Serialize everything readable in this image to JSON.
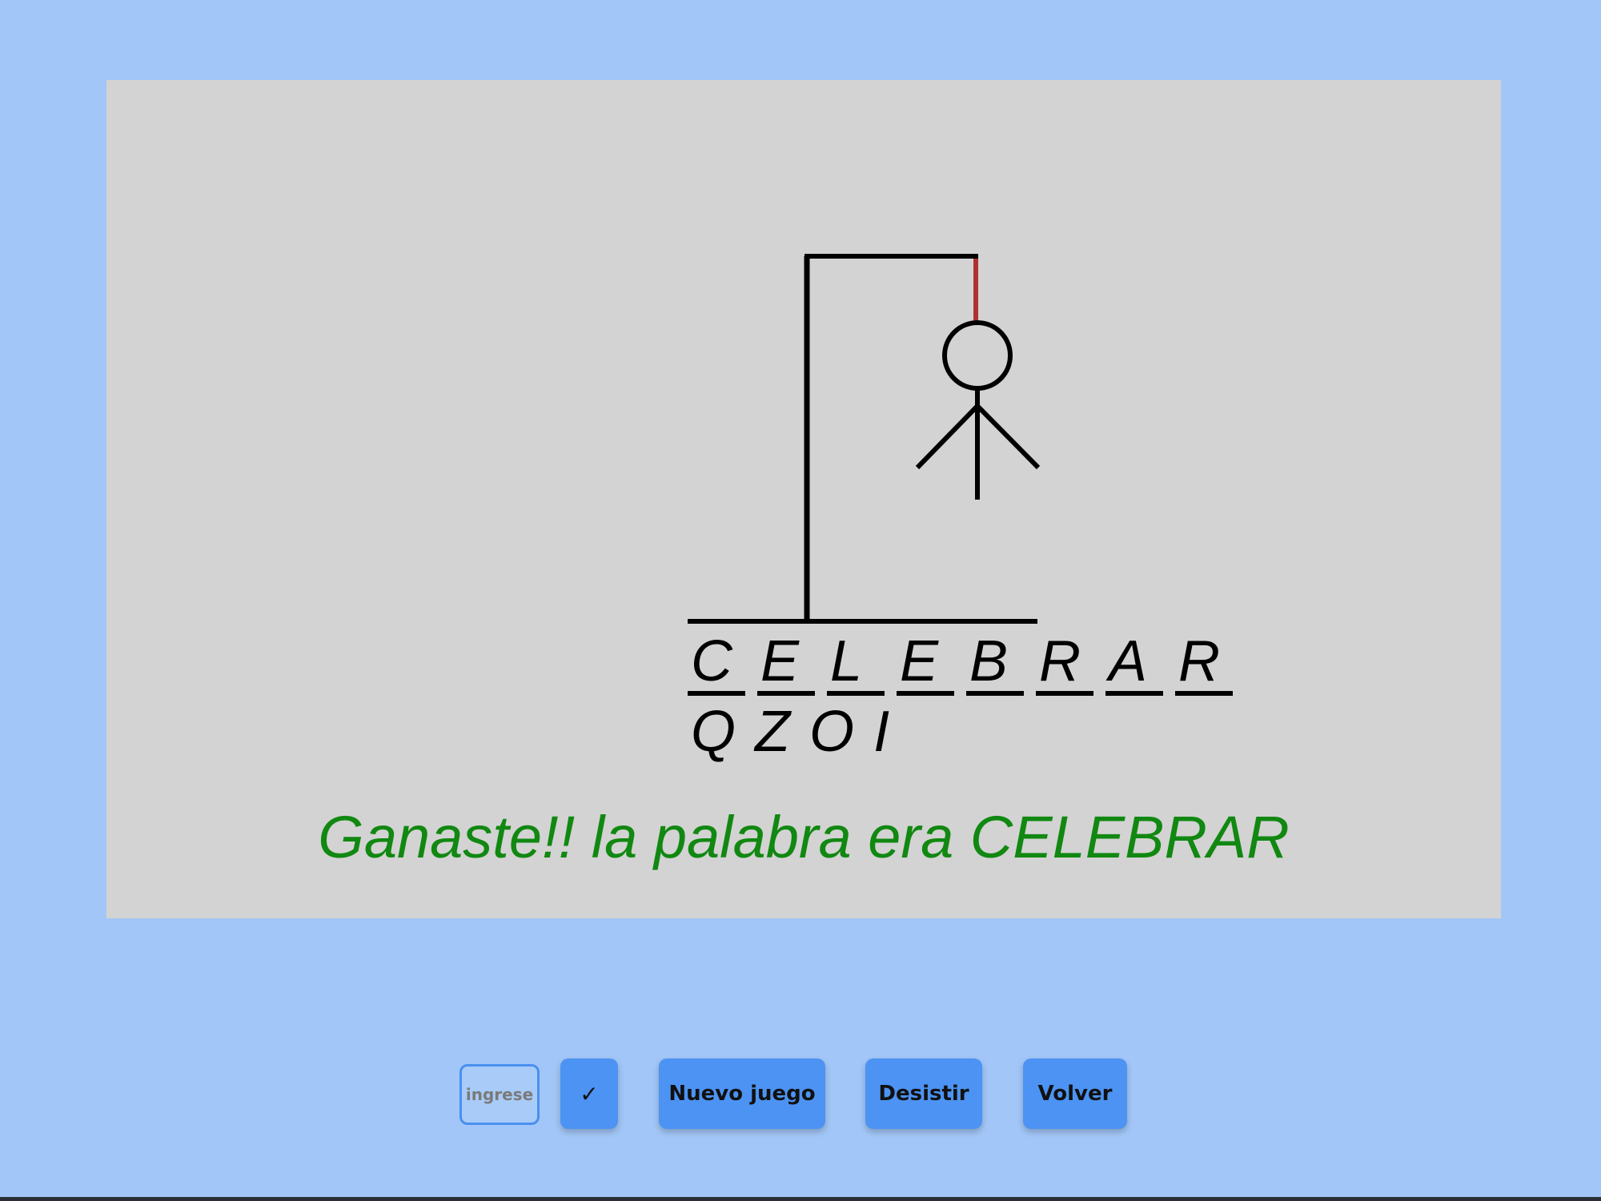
{
  "game": {
    "word_letters": [
      "C",
      "E",
      "L",
      "E",
      "B",
      "R",
      "A",
      "R"
    ],
    "wrong_letters": [
      "Q",
      "Z",
      "O",
      "I"
    ],
    "result_message": "Ganaste!! la palabra era CELEBRAR",
    "result_color": "#118811",
    "rope_color": "#b03030"
  },
  "controls": {
    "input_placeholder": "ingrese",
    "input_value": "",
    "check_label": "✓",
    "new_game_label": "Nuevo juego",
    "give_up_label": "Desistir",
    "back_label": "Volver"
  },
  "colors": {
    "page_background": "#a2c6f7",
    "canvas_background": "#d3d3d3",
    "button_background": "#4c93f3"
  }
}
